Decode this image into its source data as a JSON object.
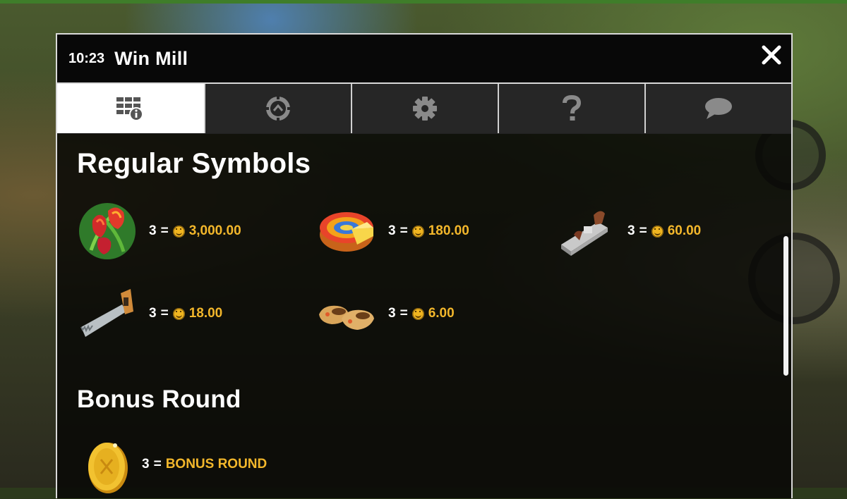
{
  "window": {
    "clock": "10:23",
    "title": "Win Mill",
    "close_label": "✕"
  },
  "tabs": [
    {
      "name": "paytable",
      "icon": "paytable-icon",
      "active": true
    },
    {
      "name": "bet",
      "icon": "chip-icon",
      "active": false
    },
    {
      "name": "settings",
      "icon": "gear-icon",
      "active": false
    },
    {
      "name": "help",
      "icon": "question-icon",
      "active": false
    },
    {
      "name": "chat",
      "icon": "chat-bubble-icon",
      "active": false
    }
  ],
  "sections": {
    "regular": {
      "title": "Regular Symbols",
      "symbols": [
        {
          "icon": "tulips-icon",
          "count": "3",
          "eq": "=",
          "amount": "3,000.00"
        },
        {
          "icon": "cheese-wheel-icon",
          "count": "3",
          "eq": "=",
          "amount": "180.00"
        },
        {
          "icon": "hand-plane-icon",
          "count": "3",
          "eq": "=",
          "amount": "60.00"
        },
        {
          "icon": "saw-icon",
          "count": "3",
          "eq": "=",
          "amount": "18.00"
        },
        {
          "icon": "clogs-icon",
          "count": "3",
          "eq": "=",
          "amount": "6.00"
        }
      ]
    },
    "bonus": {
      "title": "Bonus Round",
      "symbols": [
        {
          "icon": "gold-coin-icon",
          "count": "3",
          "eq": "=",
          "amount": "BONUS ROUND"
        }
      ]
    }
  },
  "colors": {
    "amount": "#f3b72b",
    "active_tab_bg": "#ffffff",
    "tab_bg": "#262626",
    "panel_bg": "#080806"
  }
}
